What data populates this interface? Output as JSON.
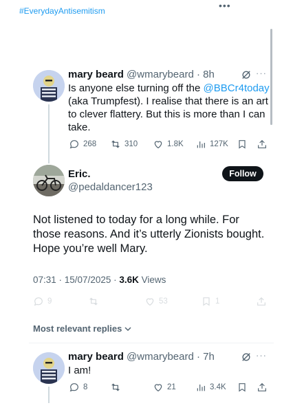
{
  "top": {
    "hashtag": "#EverydayAntisemitism",
    "more": "•••"
  },
  "quoted": {
    "name": "mary beard",
    "handle": "@wmarybeard",
    "time": "· 8h",
    "text_before": "Is anyone else turning off the ",
    "mention": "@BBCr4today",
    "text_after": " (aka Trumpfest). I realise that there is an art to clever flattery.  But this is more than I can take.",
    "replies": "268",
    "reposts": "310",
    "likes": "1.8K",
    "views": "127K",
    "more": "···"
  },
  "main": {
    "name": "Eric.",
    "handle": "@pedaldancer123",
    "follow_label": "Follow",
    "text": "Not listened to today for a long while. For those reasons. And it’s utterly Zionists bought. Hope you’re well Mary.",
    "timestamp": "07:31 · 15/07/2025 · ",
    "views_count": "3.6K",
    "views_label": " Views",
    "replies": "9",
    "likes": "53",
    "bookmarks": "1"
  },
  "sort": {
    "label": "Most relevant replies"
  },
  "reply": {
    "name": "mary beard",
    "handle": "@wmarybeard",
    "time": "· 7h",
    "text": "I am!",
    "replies": "8",
    "likes": "21",
    "views": "3.4K",
    "more": "···"
  },
  "colors": {
    "link": "#1d9bf0",
    "text": "#0f1419",
    "muted": "#536471",
    "follow_bg": "#0f1419"
  }
}
